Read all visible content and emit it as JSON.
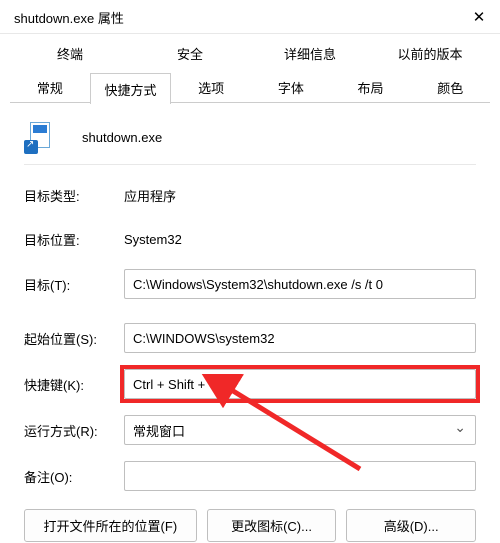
{
  "window": {
    "title": "shutdown.exe 属性"
  },
  "tabs_row1": [
    {
      "label": "终端"
    },
    {
      "label": "安全"
    },
    {
      "label": "详细信息"
    },
    {
      "label": "以前的版本"
    }
  ],
  "tabs_row2": [
    {
      "label": "常规"
    },
    {
      "label": "快捷方式",
      "active": true
    },
    {
      "label": "选项"
    },
    {
      "label": "字体"
    },
    {
      "label": "布局"
    },
    {
      "label": "颜色"
    }
  ],
  "file": {
    "name": "shutdown.exe"
  },
  "fields": {
    "target_type": {
      "label": "目标类型:",
      "value": "应用程序"
    },
    "target_location": {
      "label": "目标位置:",
      "value": "System32"
    },
    "target": {
      "label": "目标(T):",
      "value": "C:\\Windows\\System32\\shutdown.exe /s /t 0"
    },
    "start_in": {
      "label": "起始位置(S):",
      "value": "C:\\WINDOWS\\system32"
    },
    "shortcut_key": {
      "label": "快捷键(K):",
      "value": "Ctrl + Shift + Q"
    },
    "run": {
      "label": "运行方式(R):",
      "value": "常规窗口"
    },
    "comment": {
      "label": "备注(O):",
      "value": ""
    }
  },
  "buttons": {
    "open_location": "打开文件所在的位置(F)",
    "change_icon": "更改图标(C)...",
    "advanced": "高级(D)..."
  },
  "annotation": {
    "color": "#f02828"
  }
}
